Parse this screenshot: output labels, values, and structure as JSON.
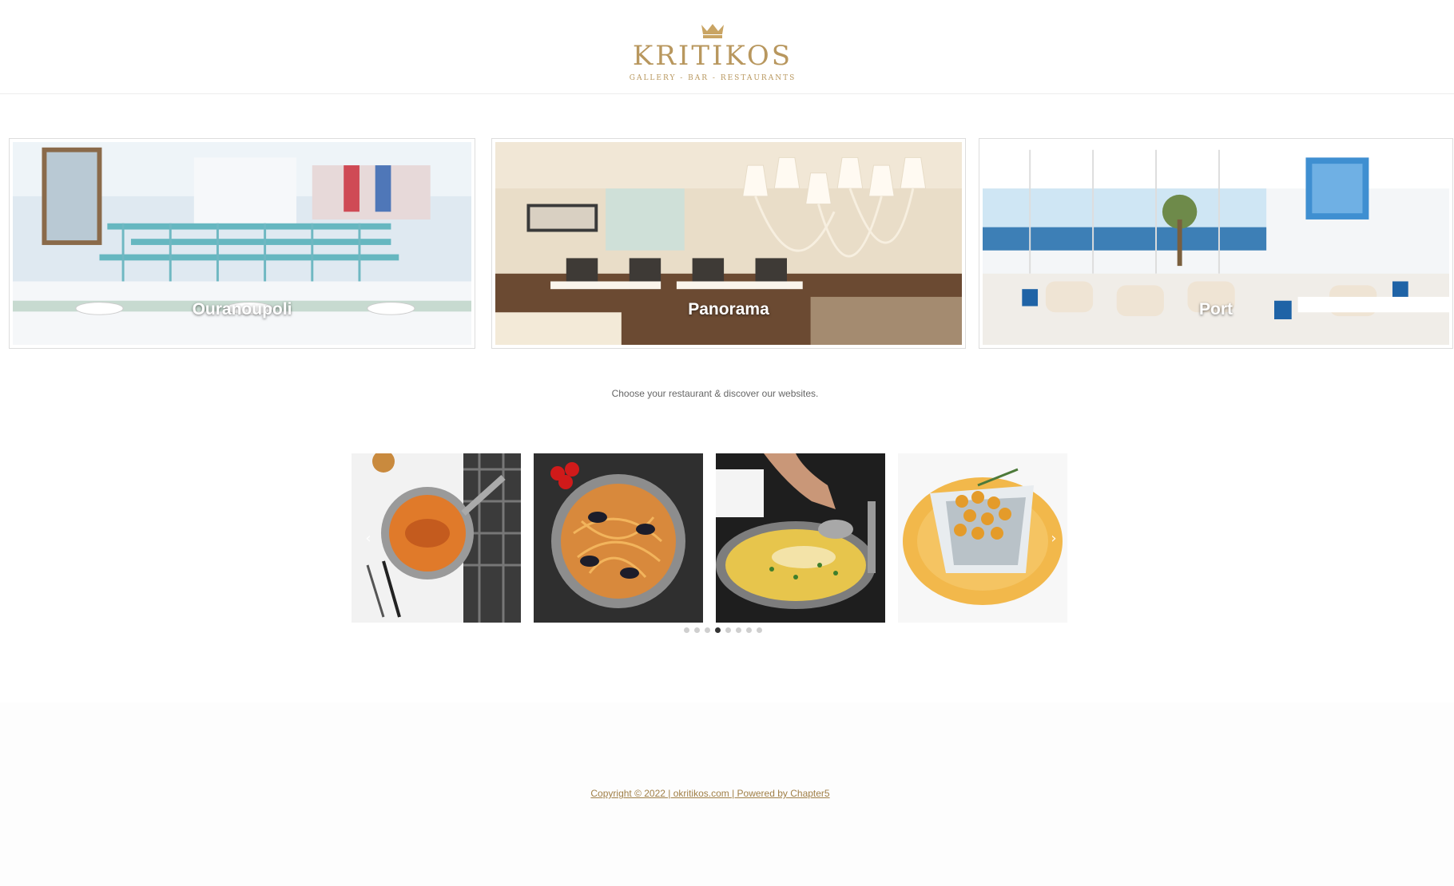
{
  "header": {
    "logo_name": "KRITIKOS",
    "logo_tagline": "GALLERY - BAR - RESTAURANTS"
  },
  "restaurants": [
    {
      "label": "Ouranoupoli"
    },
    {
      "label": "Panorama"
    },
    {
      "label": "Port"
    }
  ],
  "discover": {
    "tagline": "Choose your restaurant & discover our websites.",
    "slides": [
      {
        "icon": "dish-fish-soup"
      },
      {
        "icon": "dish-seafood-pasta"
      },
      {
        "icon": "dish-fish-in-pan"
      },
      {
        "icon": "dish-sea-bass-chickpeas"
      }
    ],
    "dots_count": 8,
    "active_dot": 3,
    "prev_arrow": "‹",
    "next_arrow": "›"
  },
  "footer": {
    "copyright": "Copyright © 2022 | okritikos.com | Powered by Chapter5"
  },
  "colors": {
    "brand_gold": "#b8975e",
    "link_gold": "#a07f46"
  }
}
